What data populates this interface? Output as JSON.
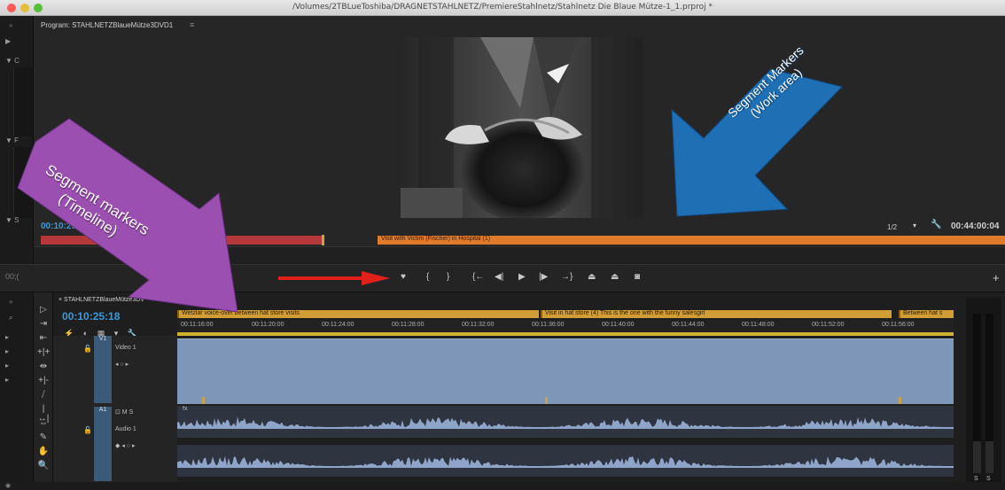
{
  "window": {
    "title": "/Volumes/2TBLueToshiba/DRAGNETSTAHLNETZ/PremiereStahlnetz/Stahlnetz Die Blaue Mütze-1_1.prproj *"
  },
  "left_strip": {
    "expand_glyph": "»",
    "items": [
      "▶",
      "▼ C",
      "▼ F",
      "▼ S"
    ]
  },
  "program_monitor": {
    "title": "Program: STAHLNETZBlaueMütze3DVD1",
    "menu_glyph": "≡",
    "timecode_current": "00:10:25:18",
    "resolution": "1/2",
    "dropdown_glyph": "▾",
    "wrench_glyph": "🔧",
    "timecode_duration": "00:44:00:04",
    "work_area_marker_label": "Visit with Victim (Fischer) in Hospital (1)"
  },
  "transport": {
    "left_timecode": "00;(",
    "buttons": [
      {
        "name": "add-marker-button",
        "glyph": "♥"
      },
      {
        "name": "mark-in-button",
        "glyph": "{"
      },
      {
        "name": "mark-out-button",
        "glyph": "}"
      },
      {
        "name": "go-to-in-button",
        "glyph": "{←"
      },
      {
        "name": "step-back-button",
        "glyph": "◀|"
      },
      {
        "name": "play-button",
        "glyph": "▶"
      },
      {
        "name": "step-forward-button",
        "glyph": "|▶"
      },
      {
        "name": "go-to-out-button",
        "glyph": "→}"
      },
      {
        "name": "lift-button",
        "glyph": "⏏"
      },
      {
        "name": "extract-button",
        "glyph": "⏏"
      },
      {
        "name": "export-frame-button",
        "glyph": "◙"
      }
    ],
    "plus_glyph": "+"
  },
  "sequence": {
    "tab_label": "× STAHLNETZBlaueMütze3DV",
    "timecode": "00:10:25:18",
    "header_icons": [
      "⚡",
      "◐",
      "▦",
      "▾",
      "🔧"
    ],
    "markers": [
      {
        "label": "Wetzlar voice-over between hat store visits"
      },
      {
        "label": "Visit in hat store (4) This is the one with the funny salesgirl"
      },
      {
        "label": "Between hat s"
      }
    ],
    "ruler_ticks": [
      "00:11:16:00",
      "00:11:20:00",
      "00:11:24:00",
      "00:11:28:00",
      "00:11:32:00",
      "00:11:36:00",
      "00:11:40:00",
      "00:11:44:00",
      "00:11:48:00",
      "00:11:52:00",
      "00:11:56:00"
    ],
    "tracks": {
      "video_id": "V1",
      "video_name": "Video 1",
      "video_controls": "◂ ○ ▸",
      "audio_controls_top": "⊡ M S",
      "audio_id": "A1",
      "audio_name": "Audio 1",
      "audio_controls_bottom": "◆ ◂ ○ ▸",
      "lock_glyph": "🔓"
    },
    "audio_clip_label": "fx"
  },
  "tools": [
    "▷",
    "⇥",
    "⇤",
    "+|+",
    "⇹",
    "+|-",
    "⧸",
    "|↔|",
    "⇔",
    "✎",
    "✋",
    "🔍"
  ],
  "meters": {
    "labels": [
      "S",
      "S"
    ]
  },
  "annotations": {
    "timeline_arrow_text": [
      "Segment markers",
      "(Timeline)"
    ],
    "workarea_arrow_text": [
      "Segment Markers",
      "(Work area)"
    ],
    "colors": {
      "purple": "#9b4fb0",
      "blue": "#1f6fb5",
      "red": "#e0201b"
    }
  }
}
